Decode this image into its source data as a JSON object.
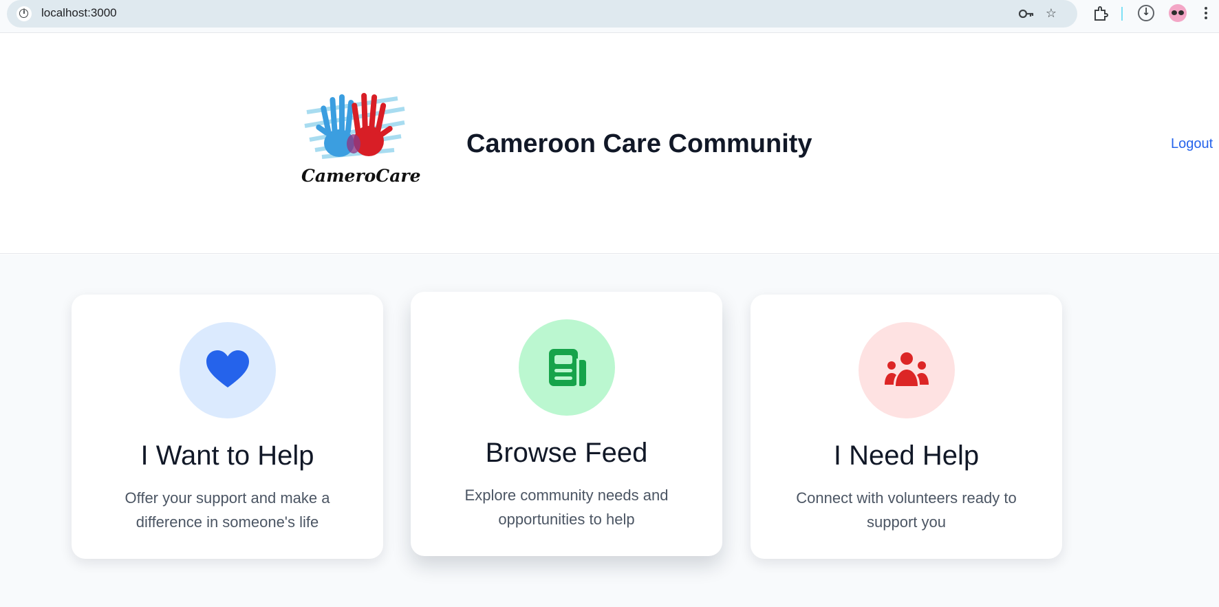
{
  "browser": {
    "url": "localhost:3000",
    "icons": [
      "info-icon",
      "password-key-icon",
      "bookmark-star-icon",
      "extensions-icon",
      "download-icon",
      "profile-avatar",
      "more-menu-icon"
    ]
  },
  "header": {
    "logo_text": "CameroCare",
    "title": "Cameroon Care Community",
    "logout_label": "Logout"
  },
  "cards": [
    {
      "title": "I Want to Help",
      "description": "Offer your support and make a difference in someone's life",
      "icon": "heart-icon",
      "circle_color": "#dbeafe",
      "icon_color": "#2563eb"
    },
    {
      "title": "Browse Feed",
      "description": "Explore community needs and opportunities to help",
      "icon": "newspaper-icon",
      "circle_color": "#bbf7d0",
      "icon_color": "#16a34a"
    },
    {
      "title": "I Need Help",
      "description": "Connect with volunteers ready to support you",
      "icon": "users-icon",
      "circle_color": "#fee2e2",
      "icon_color": "#dc2626"
    }
  ],
  "colors": {
    "accent_link": "#2563eb",
    "page_background": "#f8fafc"
  }
}
